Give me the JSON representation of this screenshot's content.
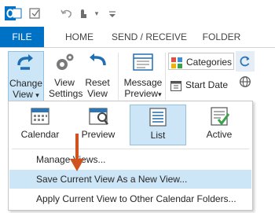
{
  "quick_access": {
    "icons": [
      "outlook-logo",
      "send-receive-icon",
      "undo-icon",
      "touch-mode-icon",
      "customize-qat-icon"
    ]
  },
  "tabs": [
    {
      "label": "FILE"
    },
    {
      "label": "HOME"
    },
    {
      "label": "SEND / RECEIVE"
    },
    {
      "label": "FOLDER"
    }
  ],
  "ribbon": {
    "change_view": {
      "line1": "Change",
      "line2": "View",
      "arrow": "▾"
    },
    "view_settings": {
      "line1": "View",
      "line2": "Settings"
    },
    "reset_view": {
      "line1": "Reset",
      "line2": "View"
    },
    "message_preview": {
      "line1": "Message",
      "line2": "Preview",
      "arrow": "▾"
    },
    "categories": "Categories",
    "start_date": "Start Date"
  },
  "dropdown": {
    "gallery": [
      {
        "label": "Calendar",
        "icon": "calendar-icon"
      },
      {
        "label": "Preview",
        "icon": "preview-icon"
      },
      {
        "label": "List",
        "icon": "list-icon",
        "selected": true
      },
      {
        "label": "Active",
        "icon": "active-icon"
      }
    ],
    "menu": [
      {
        "label": "Manage Views..."
      },
      {
        "label": "Save Current View As a New View..."
      },
      {
        "label": "Apply Current View to Other Calendar Folders..."
      }
    ]
  },
  "colors": {
    "file_tab": "#0072c6",
    "highlight": "#cde6f7",
    "arrow": "#d0521f"
  }
}
